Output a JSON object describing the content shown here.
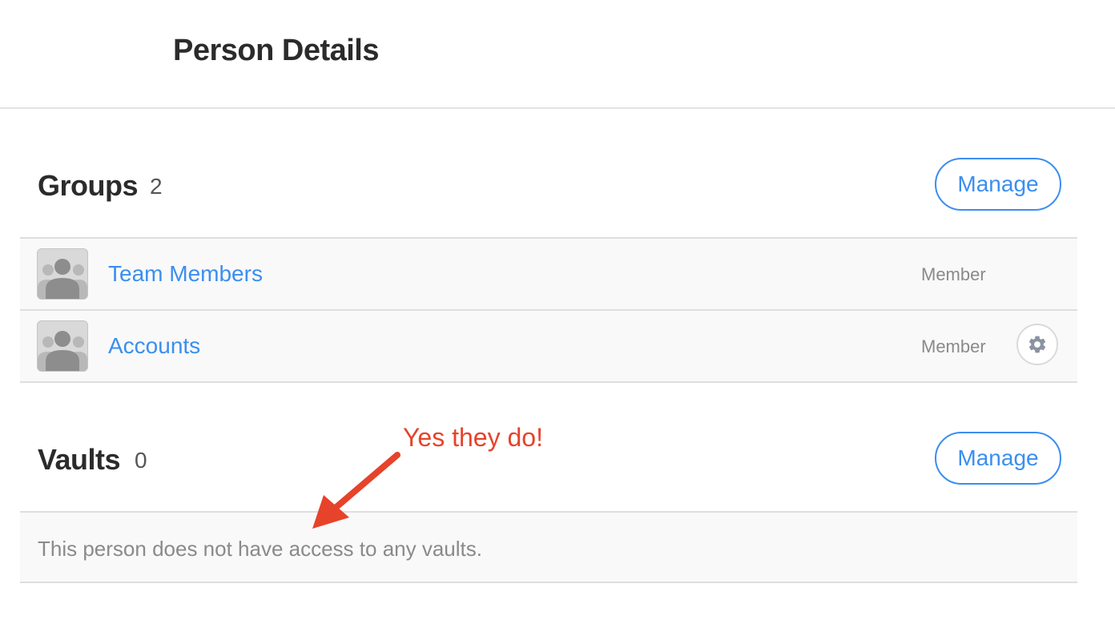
{
  "page": {
    "title": "Person Details"
  },
  "groups": {
    "title": "Groups",
    "count": "2",
    "manage_label": "Manage",
    "items": [
      {
        "name": "Team Members",
        "role": "Member"
      },
      {
        "name": "Accounts",
        "role": "Member"
      }
    ]
  },
  "vaults": {
    "title": "Vaults",
    "count": "0",
    "manage_label": "Manage",
    "empty_message": "This person does not have access to any vaults."
  },
  "annotation": {
    "text": "Yes they do!",
    "color": "#e6432a"
  },
  "colors": {
    "accent": "#3b8ef0",
    "muted": "#8a8a8a"
  },
  "icons": {
    "group_avatar": "group-avatar-icon",
    "settings": "gear-icon",
    "arrow": "arrow-icon"
  }
}
